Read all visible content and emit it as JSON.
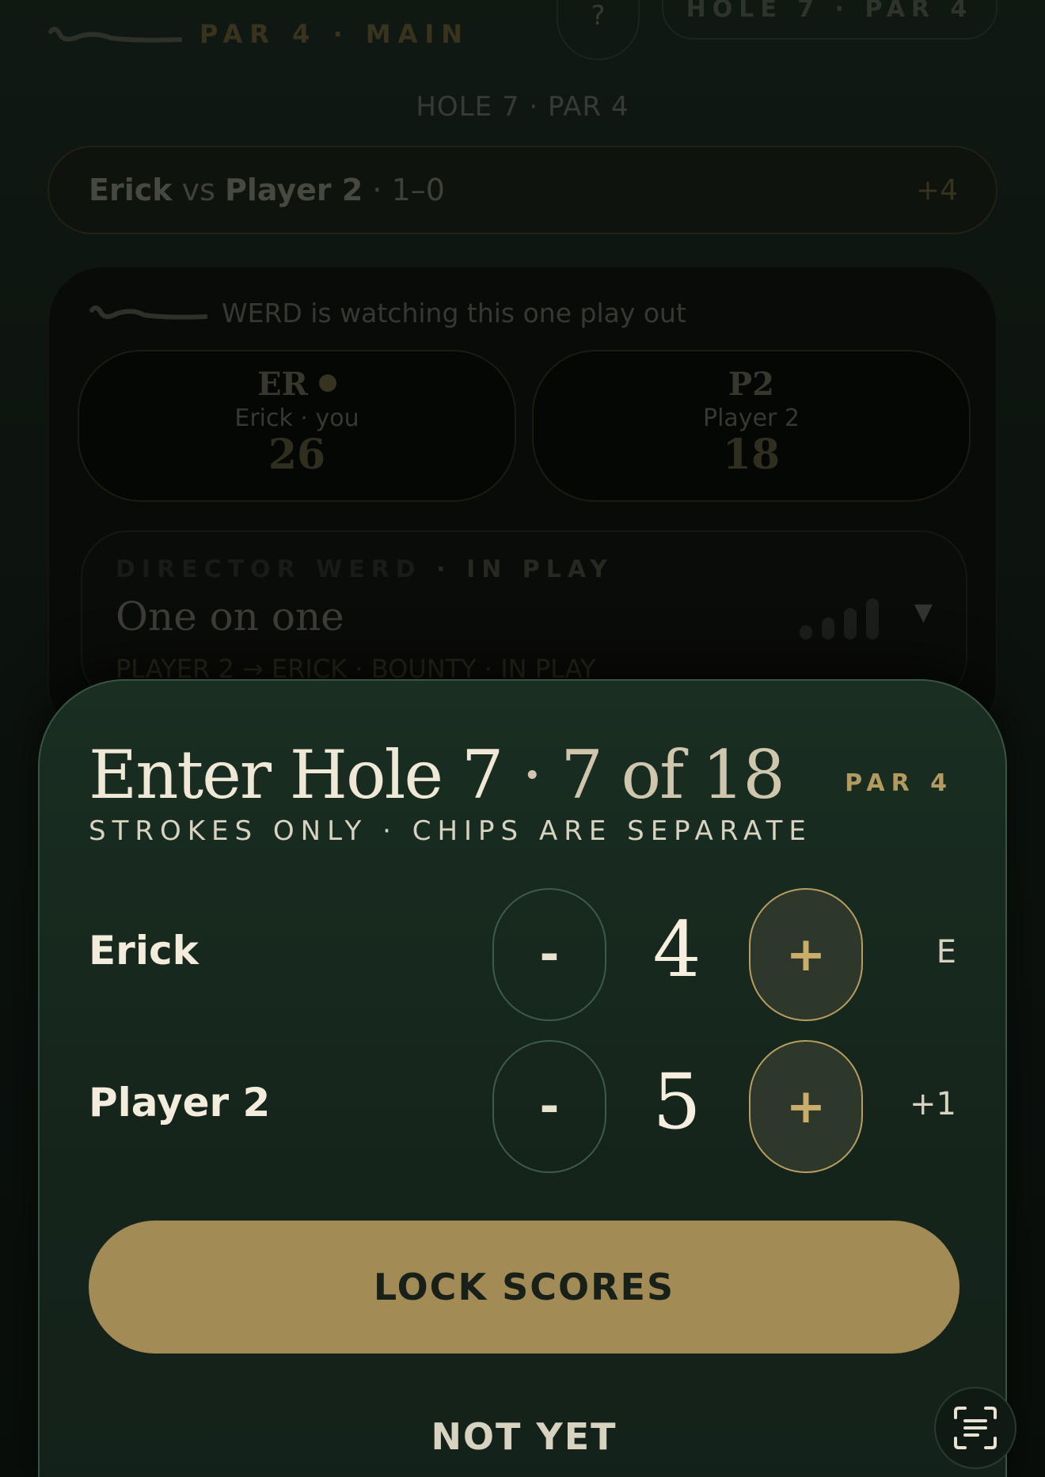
{
  "header": {
    "top_label": "PAR 4 · MAIN",
    "help_glyph": "?",
    "hole_pill": "HOLE 7 · PAR 4",
    "sub_label": "HOLE 7 · PAR 4"
  },
  "match": {
    "player_a": "Erick",
    "vs": "vs",
    "player_b": "Player 2",
    "record": "· 1–0",
    "diff": "+4"
  },
  "watch": {
    "text": "WERD is watching this one play out"
  },
  "players": [
    {
      "initials": "ER",
      "name": "Erick · you",
      "score": "26"
    },
    {
      "initials": "P2",
      "name": "Player 2",
      "score": "18"
    }
  ],
  "director": {
    "label": "DIRECTOR WERD",
    "status": "· IN PLAY",
    "title": "One on one",
    "subtitle": "PLAYER 2 → ERICK · BOUNTY · IN PLAY",
    "caret": "▼"
  },
  "sheet": {
    "title_main": "Enter Hole 7",
    "title_sep": " · ",
    "title_progress": "7 of 18",
    "par": "PAR 4",
    "subtitle": "STROKES ONLY · CHIPS ARE SEPARATE",
    "rows": [
      {
        "name": "Erick",
        "minus": "-",
        "value": "4",
        "plus": "+",
        "relative": "E"
      },
      {
        "name": "Player 2",
        "minus": "-",
        "value": "5",
        "plus": "+",
        "relative": "+1"
      }
    ],
    "lock_label": "LOCK SCORES",
    "cancel_label": "NOT YET"
  },
  "colors": {
    "accent_gold": "#a38b55",
    "sheet_bg": "#1a2e22",
    "text_cream": "#f0e8d6"
  },
  "icons": {
    "logo": "club-swoosh-icon",
    "scan": "scan-text-icon"
  }
}
